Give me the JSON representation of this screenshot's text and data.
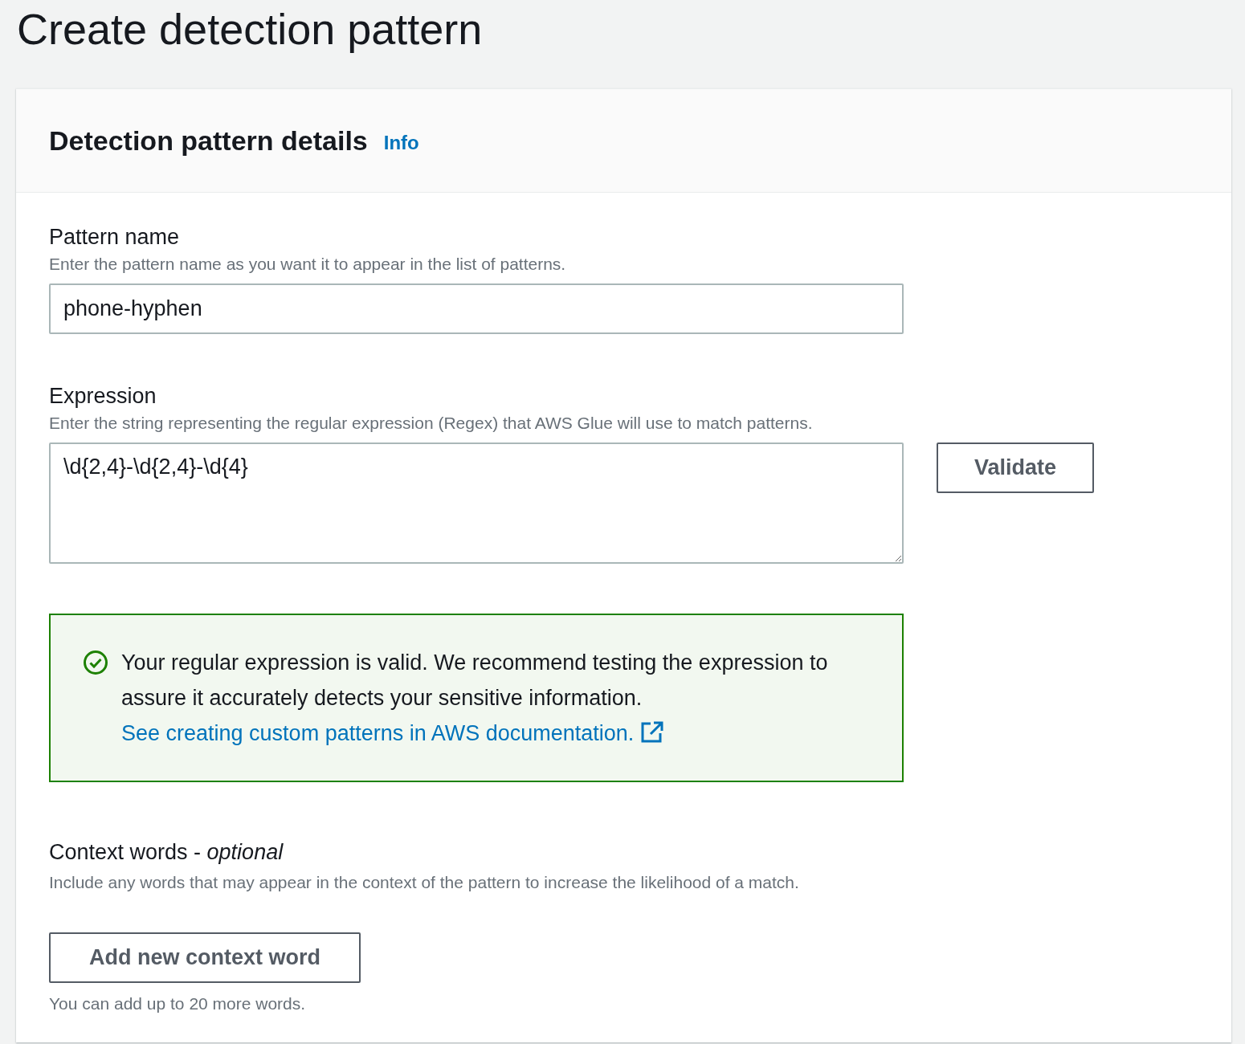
{
  "page_title": "Create detection pattern",
  "panel": {
    "heading": "Detection pattern details",
    "info_link": "Info",
    "fields": [
      {
        "kind": "input",
        "label": "Pattern name",
        "description": "Enter the pattern name as you want it to appear in the list of patterns.",
        "value": "phone-hyphen"
      },
      {
        "kind": "textarea",
        "label": "Expression",
        "description": "Enter the string representing the regular expression (Regex) that AWS Glue will use to match patterns.",
        "value": "\\d{2,4}-\\d{2,4}-\\d{4}",
        "button": "Validate"
      }
    ],
    "alert": {
      "kind": "success",
      "text": "Your regular expression is valid. We recommend testing the expression to assure it accurately detects your sensitive information.",
      "link": "See creating custom patterns in AWS documentation."
    },
    "context": {
      "label": "Context words - *optional*",
      "description": "Include any words that may appear in the context of the pattern to increase the likelihood of a match.",
      "button": "Add new context word",
      "note": "You can add up to 20 more words."
    }
  }
}
